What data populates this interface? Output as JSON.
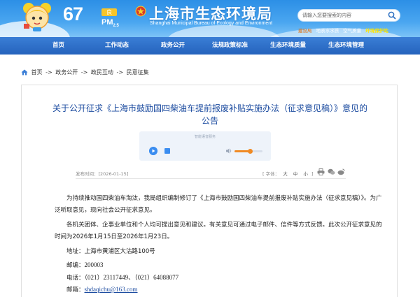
{
  "header": {
    "aqi_value": "67",
    "aqi_level": "良",
    "pm_label": "PM",
    "pm_sub": "2.5",
    "site_title": "上海市生态环境局",
    "site_subtitle": "Shanghai Municipal Bureau of Ecology and Environment",
    "search_placeholder": "请输入您要搜索的内容",
    "quick_links": [
      "建设局",
      "地表水水质",
      "空气质量",
      "环境保护站"
    ]
  },
  "nav": {
    "items": [
      "首页",
      "工作动态",
      "政务公开",
      "法规政策标准",
      "生态环境质量",
      "生态环境管理"
    ]
  },
  "breadcrumb": {
    "items": [
      "首页",
      "政务公开",
      "政民互动",
      "民意征集"
    ],
    "separator": "->"
  },
  "article": {
    "title": "关于公开征求《上海市鼓励国四柴油车提前报废补贴实施办法（征求意见稿）》意见的公告",
    "audio_label": "智能语音服务",
    "audio_volume": 0.55,
    "publish_date": "发布时间：[2026-01-15]",
    "font_size_label": "[ 字体：",
    "font_big": "大",
    "font_mid": "中",
    "font_small": "小",
    "font_size_close": "]",
    "paragraph_1": "为持续推动国四柴油车淘汰，我局组织编制修订了《上海市鼓励国四柴油车提前报废补贴实施办法（征求意见稿）》。为广泛听取意见，现向社会公开征求意见。",
    "paragraph_2": "各机关团体、企事业单位和个人均可提出意见和建议。有关意见可通过电子邮件、信件等方式反馈。此次公开征求意见的时间为2026年1月15日至2026年1月23日。",
    "contact": {
      "address_label": "地址：",
      "address": "上海市黄浦区大沽路100号",
      "zip_label": "邮编：",
      "zip": "200003",
      "phone_label": "电话：",
      "phone": "（021）23117449、（021）64088077",
      "email_label": "邮箱：",
      "email": "shdaqichu@163.com"
    }
  },
  "colors": {
    "header_blue": "#2c8fe6",
    "nav_blue": "#2d6fc9",
    "title_blue": "#1a4a9f",
    "aqi_badge": "#f7c52a",
    "audio_accent": "#f08a24"
  },
  "icons": [
    "mascot-icon",
    "emblem-icon",
    "search-icon",
    "home-icon",
    "play-icon",
    "stop-icon",
    "volume-icon",
    "print-icon",
    "wechat-icon",
    "weibo-icon"
  ]
}
